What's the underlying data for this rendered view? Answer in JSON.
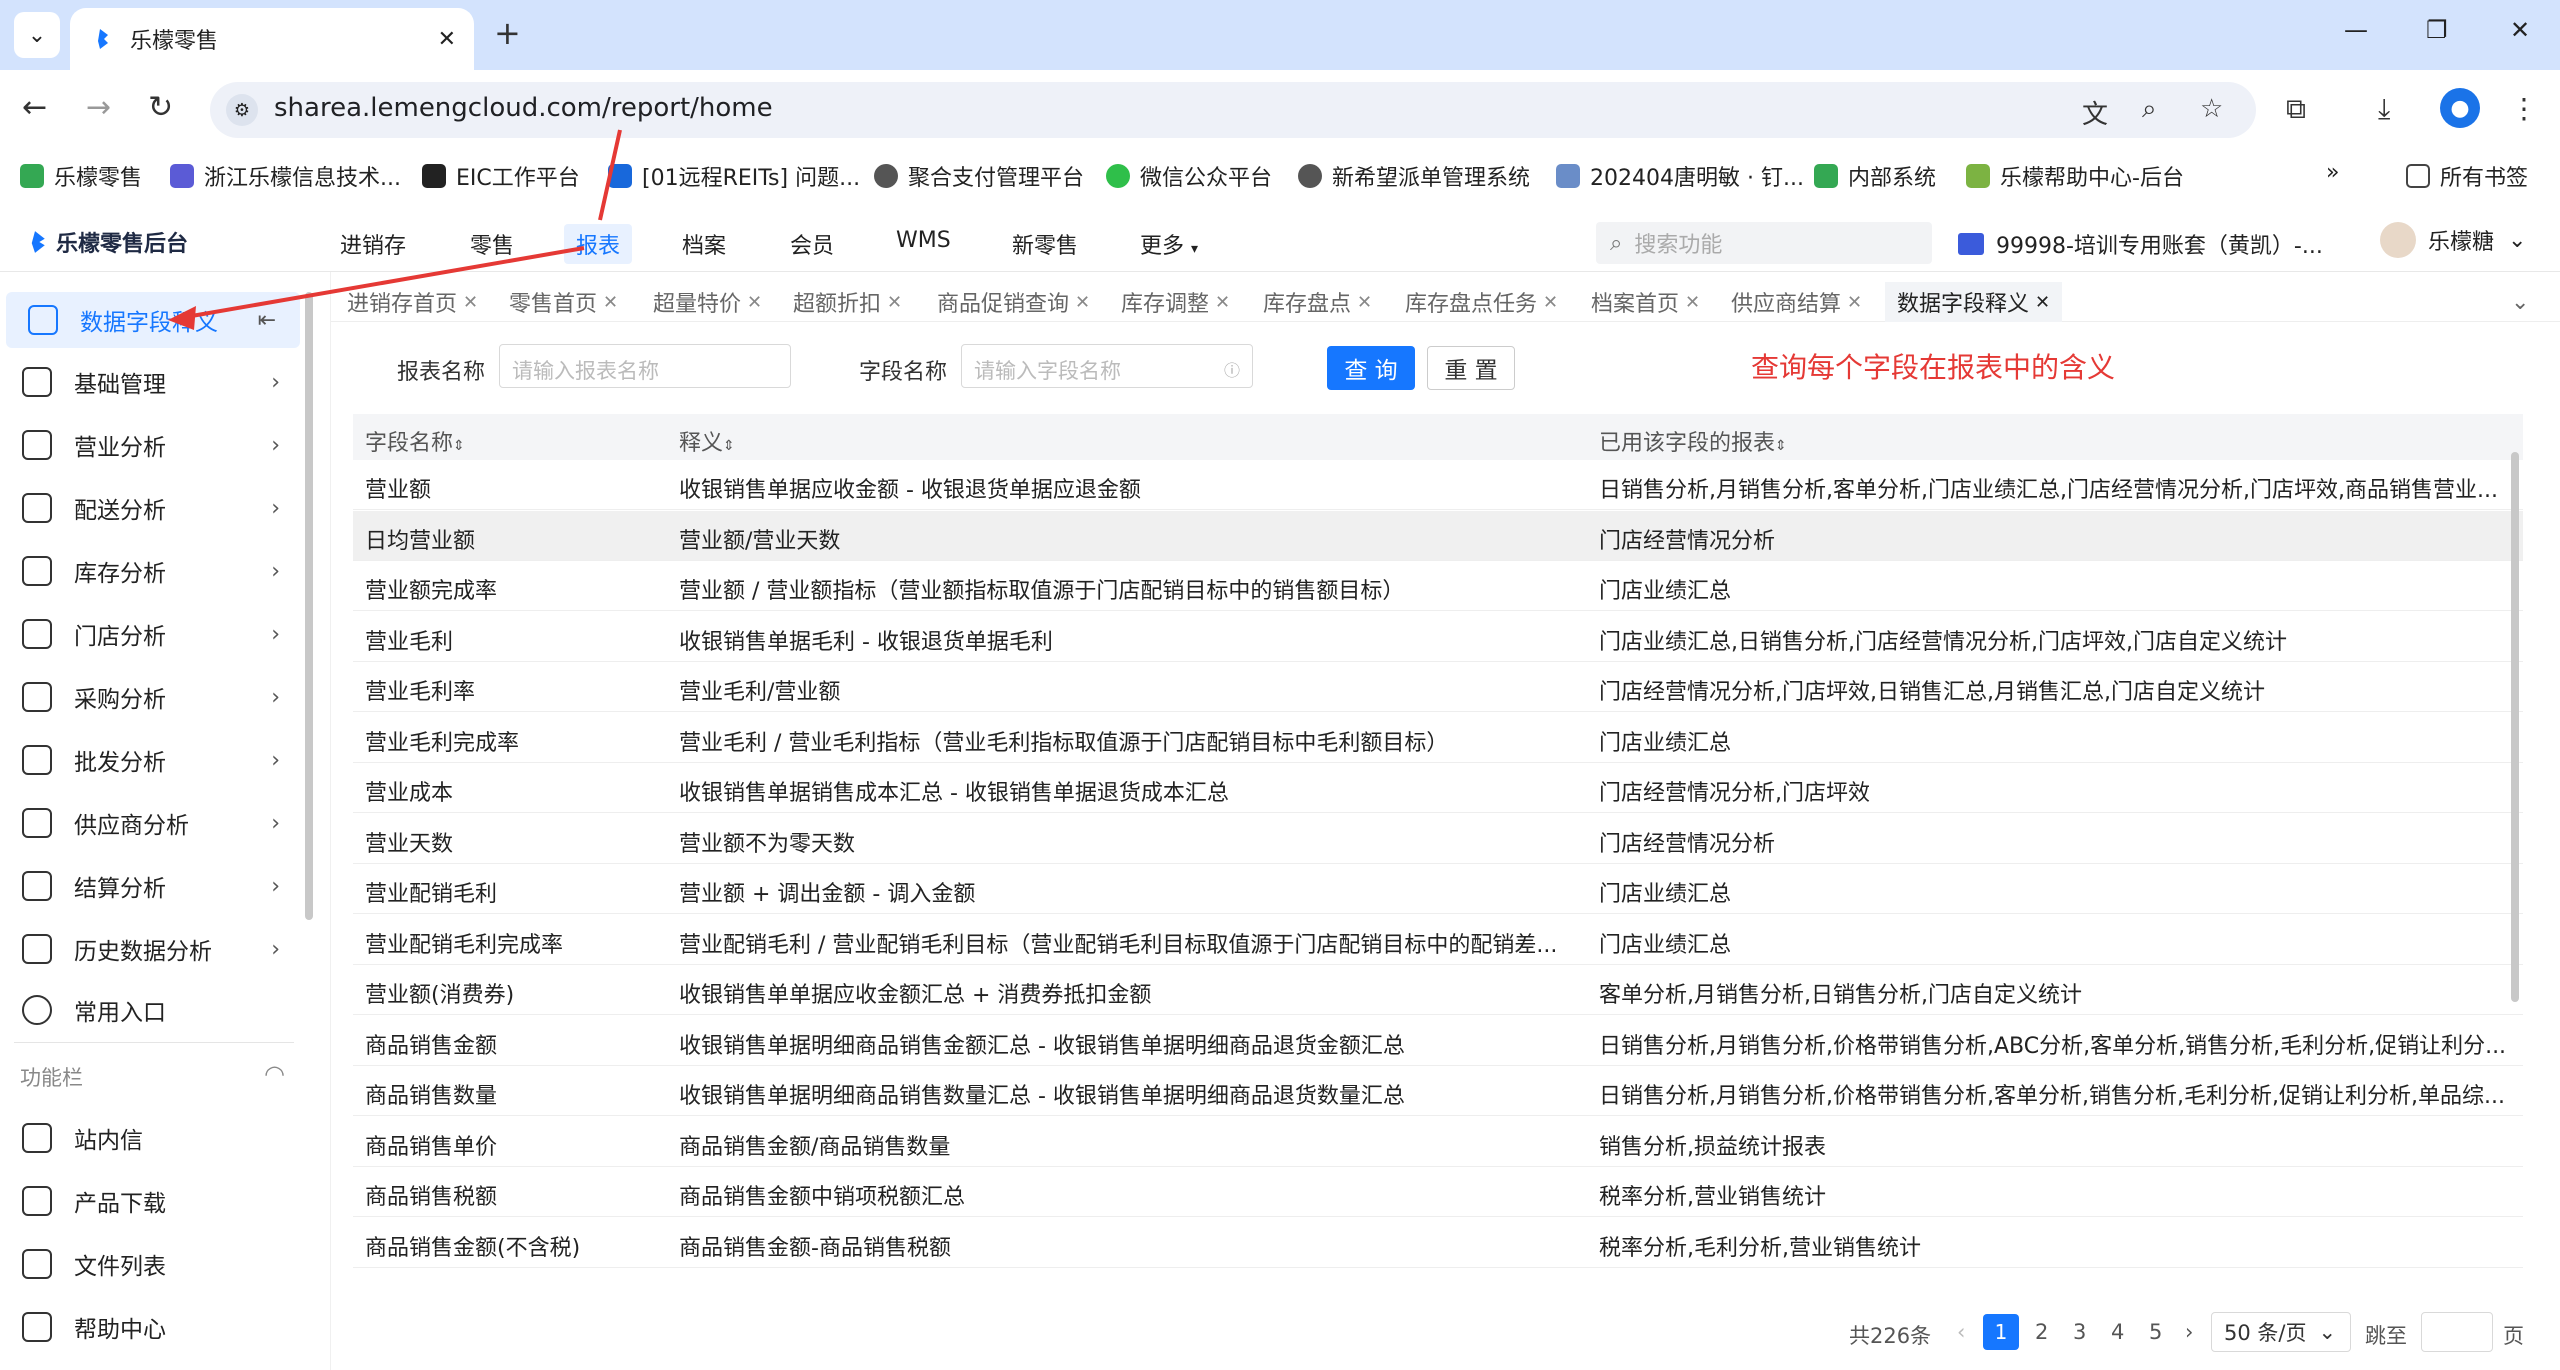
{
  "browser": {
    "tab_title": "乐檬零售",
    "url": "sharea.lemengcloud.com/report/home",
    "colors": {
      "frame": "#d3e3fd",
      "accent": "#1677ff"
    }
  },
  "bookmarks": [
    {
      "label": "乐檬零售",
      "icon": "lemon-icon"
    },
    {
      "label": "浙江乐檬信息技术...",
      "icon": "company-icon"
    },
    {
      "label": "EIC工作平台",
      "icon": "eic-icon"
    },
    {
      "label": "[01远程REITs] 问题...",
      "icon": "jira-icon"
    },
    {
      "label": "聚合支付管理平台",
      "icon": "globe-icon"
    },
    {
      "label": "微信公众平台",
      "icon": "wechat-icon"
    },
    {
      "label": "新希望派单管理系统",
      "icon": "globe-icon"
    },
    {
      "label": "202404唐明敏 · 钉...",
      "icon": "doc-icon"
    },
    {
      "label": "内部系统",
      "icon": "lemon-icon"
    },
    {
      "label": "乐檬帮助中心-后台",
      "icon": "help-icon"
    },
    {
      "label": "所有书签",
      "icon": "folder-icon"
    }
  ],
  "header": {
    "logo": "乐檬零售后台",
    "nav": [
      "进销存",
      "零售",
      "报表",
      "档案",
      "会员",
      "WMS",
      "新零售",
      "更多"
    ],
    "active_nav": "报表",
    "search_placeholder": "搜索功能",
    "account": "99998-培训专用账套（黄凯）-...",
    "user": "乐檬糖"
  },
  "sidebar": {
    "items": [
      {
        "label": "数据字段释义",
        "icon": "monitor-icon",
        "active": true
      },
      {
        "label": "基础管理",
        "icon": "box-icon"
      },
      {
        "label": "营业分析",
        "icon": "store-icon"
      },
      {
        "label": "配送分析",
        "icon": "truck-icon"
      },
      {
        "label": "库存分析",
        "icon": "inventory-icon"
      },
      {
        "label": "门店分析",
        "icon": "shop-icon"
      },
      {
        "label": "采购分析",
        "icon": "cart-icon"
      },
      {
        "label": "批发分析",
        "icon": "wholesale-icon"
      },
      {
        "label": "供应商分析",
        "icon": "supplier-icon"
      },
      {
        "label": "结算分析",
        "icon": "dollar-icon"
      },
      {
        "label": "历史数据分析",
        "icon": "chart-icon"
      },
      {
        "label": "常用入口",
        "icon": "heart-icon"
      }
    ],
    "section_label": "功能栏",
    "tools": [
      {
        "label": "站内信",
        "icon": "mail-icon"
      },
      {
        "label": "产品下载",
        "icon": "download-icon"
      },
      {
        "label": "文件列表",
        "icon": "file-icon"
      },
      {
        "label": "帮助中心",
        "icon": "help-icon"
      }
    ]
  },
  "page_tabs": [
    "进销存首页",
    "零售首页",
    "超量特价",
    "超额折扣",
    "商品促销查询",
    "库存调整",
    "库存盘点",
    "库存盘点任务",
    "档案首页",
    "供应商结算",
    "数据字段释义"
  ],
  "filter": {
    "report_label": "报表名称",
    "report_placeholder": "请输入报表名称",
    "field_label": "字段名称",
    "field_placeholder": "请输入字段名称",
    "query": "查 询",
    "reset": "重 置"
  },
  "annotation": "查询每个字段在报表中的含义",
  "table": {
    "headers": [
      "字段名称",
      "释义",
      "已用该字段的报表"
    ],
    "rows": [
      [
        "营业额",
        "收银销售单据应收金额 - 收银退货单据应退金额",
        "日销售分析,月销售分析,客单分析,门店业绩汇总,门店经营情况分析,门店坪效,商品销售营业..."
      ],
      [
        "日均营业额",
        "营业额/营业天数",
        "门店经营情况分析"
      ],
      [
        "营业额完成率",
        "营业额 / 营业额指标（营业额指标取值源于门店配销目标中的销售额目标）",
        "门店业绩汇总"
      ],
      [
        "营业毛利",
        "收银销售单据毛利 - 收银退货单据毛利",
        "门店业绩汇总,日销售分析,门店经营情况分析,门店坪效,门店自定义统计"
      ],
      [
        "营业毛利率",
        "营业毛利/营业额",
        "门店经营情况分析,门店坪效,日销售汇总,月销售汇总,门店自定义统计"
      ],
      [
        "营业毛利完成率",
        "营业毛利 / 营业毛利指标（营业毛利指标取值源于门店配销目标中毛利额目标）",
        "门店业绩汇总"
      ],
      [
        "营业成本",
        "收银销售单据销售成本汇总 - 收银销售单据退货成本汇总",
        "门店经营情况分析,门店坪效"
      ],
      [
        "营业天数",
        "营业额不为零天数",
        "门店经营情况分析"
      ],
      [
        "营业配销毛利",
        "营业额 + 调出金额 - 调入金额",
        "门店业绩汇总"
      ],
      [
        "营业配销毛利完成率",
        "营业配销毛利 / 营业配销毛利目标（营业配销毛利目标取值源于门店配销目标中的配销差...",
        "门店业绩汇总"
      ],
      [
        "营业额(消费券)",
        "收银销售单单据应收金额汇总 + 消费券抵扣金额",
        "客单分析,月销售分析,日销售分析,门店自定义统计"
      ],
      [
        "商品销售金额",
        "收银销售单据明细商品销售金额汇总 - 收银销售单据明细商品退货金额汇总",
        "日销售分析,月销售分析,价格带销售分析,ABC分析,客单分析,销售分析,毛利分析,促销让利分..."
      ],
      [
        "商品销售数量",
        "收银销售单据明细商品销售数量汇总 - 收银销售单据明细商品退货数量汇总",
        "日销售分析,月销售分析,价格带销售分析,客单分析,销售分析,毛利分析,促销让利分析,单品综..."
      ],
      [
        "商品销售单价",
        "商品销售金额/商品销售数量",
        "销售分析,损益统计报表"
      ],
      [
        "商品销售税额",
        "商品销售金额中销项税额汇总",
        "税率分析,营业销售统计"
      ],
      [
        "商品销售金额(不含税)",
        "商品销售金额-商品销售税额",
        "税率分析,毛利分析,营业销售统计"
      ]
    ]
  },
  "pager": {
    "total": "共226条",
    "pages": [
      "1",
      "2",
      "3",
      "4",
      "5"
    ],
    "current": "1",
    "size": "50 条/页",
    "jump": "跳至",
    "page_unit": "页"
  }
}
